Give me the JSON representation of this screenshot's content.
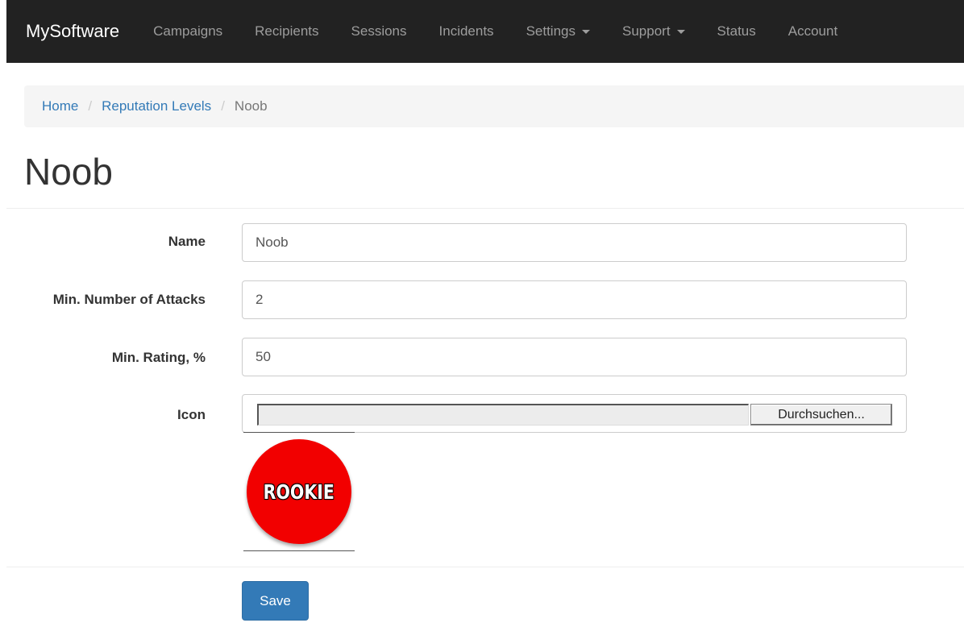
{
  "navbar": {
    "brand": "MySoftware",
    "items": [
      {
        "label": "Campaigns"
      },
      {
        "label": "Recipients"
      },
      {
        "label": "Sessions"
      },
      {
        "label": "Incidents"
      },
      {
        "label": "Settings"
      },
      {
        "label": "Support"
      },
      {
        "label": "Status"
      },
      {
        "label": "Account"
      }
    ]
  },
  "breadcrumb": {
    "home": "Home",
    "sep": "/",
    "parent": "Reputation Levels",
    "current": "Noob"
  },
  "page": {
    "title": "Noob"
  },
  "form": {
    "name_label": "Name",
    "name_value": "Noob",
    "min_attacks_label": "Min. Number of Attacks",
    "min_attacks_value": "2",
    "min_rating_label": "Min. Rating, %",
    "min_rating_value": "50",
    "icon_label": "Icon",
    "browse_label": "Durchsuchen...",
    "icon_badge_text": "ROOKIE",
    "save_label": "Save"
  },
  "colors": {
    "navbar_bg": "#222222",
    "link": "#337ab7",
    "primary_button": "#337ab7",
    "badge_red": "#f20000"
  }
}
